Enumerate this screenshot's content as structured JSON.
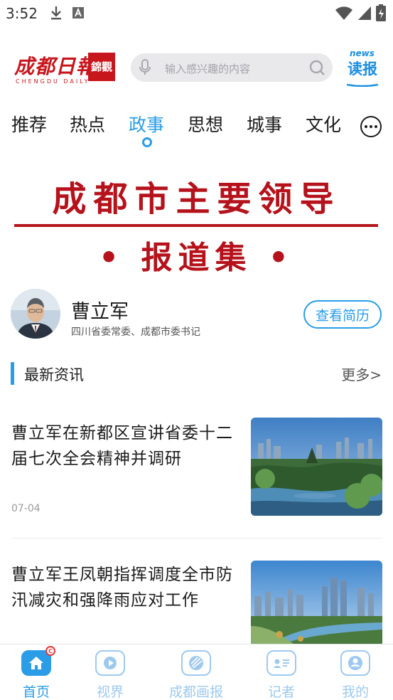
{
  "status_bar": {
    "time": "3:52"
  },
  "header": {
    "logo_text": "成都日報",
    "logo_sub": "CHENGDU DAILY",
    "logo_badge": "錦觀",
    "search_placeholder": "输入感兴趣的内容",
    "read_news_top": "news",
    "read_news_label": "读报"
  },
  "tabs": [
    "推荐",
    "热点",
    "政事",
    "思想",
    "城事",
    "文化"
  ],
  "active_tab": "政事",
  "banner": {
    "title": "成都市主要领导",
    "subtitle": "• 报道集 •"
  },
  "leader": {
    "name": "曹立军",
    "title": "四川省委常委、成都市委书记",
    "resume_button": "查看简历"
  },
  "section": {
    "title": "最新资讯",
    "more": "更多>"
  },
  "news": [
    {
      "title": "曹立军在新都区宣讲省委十二届七次全会精神并调研",
      "date": "07-04"
    },
    {
      "title": "曹立军王凤朝指挥调度全市防汛减灾和强降雨应对工作",
      "date": ""
    }
  ],
  "bottom_nav": [
    {
      "label": "首页",
      "icon": "home-icon",
      "active": true
    },
    {
      "label": "视界",
      "icon": "play-icon",
      "active": false
    },
    {
      "label": "成都画报",
      "icon": "magazine-icon",
      "active": false
    },
    {
      "label": "记者",
      "icon": "reporter-card-icon",
      "active": false
    },
    {
      "label": "我的",
      "icon": "profile-icon",
      "active": false
    }
  ],
  "colors": {
    "accent": "#2a9de6",
    "brand_red": "#b5121b"
  }
}
